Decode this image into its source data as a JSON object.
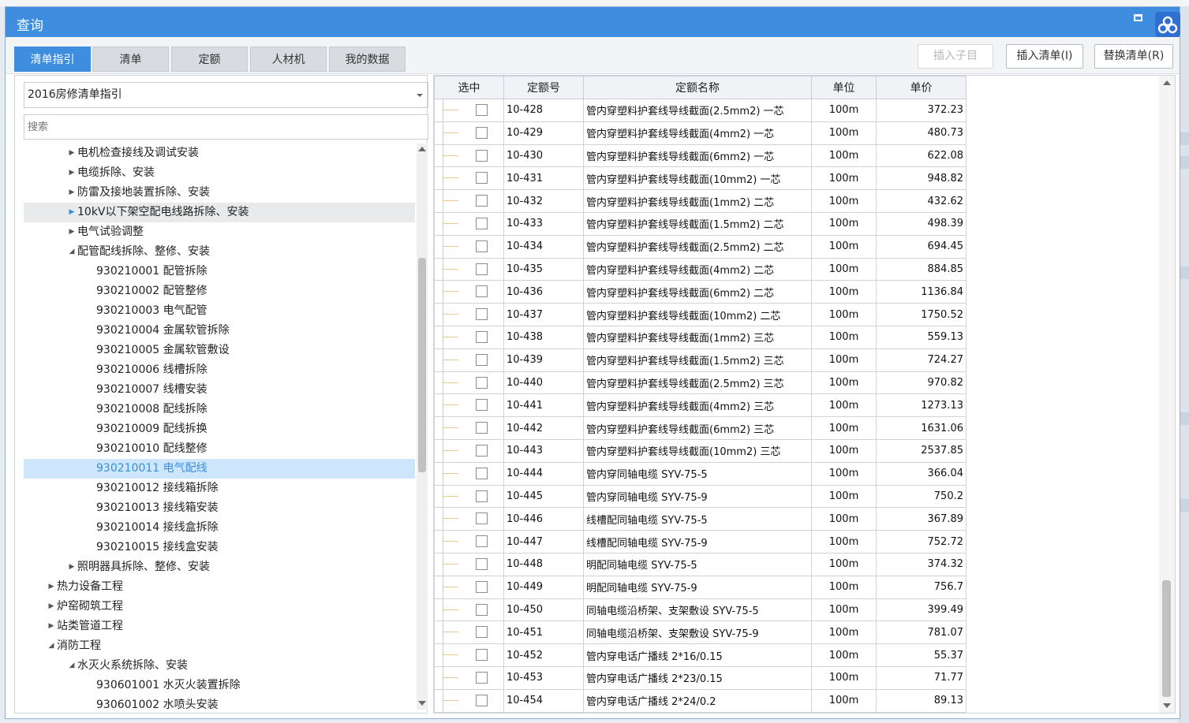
{
  "window": {
    "title": "查询"
  },
  "tabs": [
    {
      "label": "清单指引",
      "active": true
    },
    {
      "label": "清单",
      "active": false
    },
    {
      "label": "定额",
      "active": false
    },
    {
      "label": "人材机",
      "active": false
    },
    {
      "label": "我的数据",
      "active": false
    }
  ],
  "toolbar": {
    "insert_child": "插入子目",
    "insert_list": "插入清单(I)",
    "replace_list": "替换清单(R)"
  },
  "left": {
    "dropdown_value": "2016房修清单指引",
    "search_placeholder": "搜索",
    "tree": [
      {
        "text": "电机检查接线及调试安装",
        "level": 1,
        "state": "collapsed"
      },
      {
        "text": "电缆拆除、安装",
        "level": 1,
        "state": "collapsed"
      },
      {
        "text": "防雷及接地装置拆除、安装",
        "level": 1,
        "state": "collapsed"
      },
      {
        "text": "10kV以下架空配电线路拆除、安装",
        "level": 1,
        "state": "collapsed",
        "hover": true
      },
      {
        "text": "电气试验调整",
        "level": 1,
        "state": "collapsed"
      },
      {
        "text": "配管配线拆除、整修、安装",
        "level": 1,
        "state": "expanded"
      },
      {
        "text": "930210001  配管拆除",
        "level": 2
      },
      {
        "text": "930210002  配管整修",
        "level": 2
      },
      {
        "text": "930210003  电气配管",
        "level": 2
      },
      {
        "text": "930210004  金属软管拆除",
        "level": 2
      },
      {
        "text": "930210005  金属软管敷设",
        "level": 2
      },
      {
        "text": "930210006  线槽拆除",
        "level": 2
      },
      {
        "text": "930210007  线槽安装",
        "level": 2
      },
      {
        "text": "930210008  配线拆除",
        "level": 2
      },
      {
        "text": "930210009  配线拆换",
        "level": 2
      },
      {
        "text": "930210010  配线整修",
        "level": 2
      },
      {
        "text": "930210011  电气配线",
        "level": 2,
        "selected": true
      },
      {
        "text": "930210012  接线箱拆除",
        "level": 2
      },
      {
        "text": "930210013  接线箱安装",
        "level": 2
      },
      {
        "text": "930210014  接线盒拆除",
        "level": 2
      },
      {
        "text": "930210015  接线盒安装",
        "level": 2
      },
      {
        "text": "照明器具拆除、整修、安装",
        "level": 1,
        "state": "collapsed"
      },
      {
        "text": "热力设备工程",
        "level": 0,
        "state": "collapsed"
      },
      {
        "text": "炉窑砌筑工程",
        "level": 0,
        "state": "collapsed"
      },
      {
        "text": "站类管道工程",
        "level": 0,
        "state": "collapsed"
      },
      {
        "text": "消防工程",
        "level": 0,
        "state": "expanded"
      },
      {
        "text": "水灭火系统拆除、安装",
        "level": 1,
        "state": "expanded"
      },
      {
        "text": "930601001  水灭火装置拆除",
        "level": 2
      },
      {
        "text": "930601002  水喷头安装",
        "level": 2
      }
    ]
  },
  "grid": {
    "columns": [
      "选中",
      "定额号",
      "定额名称",
      "单位",
      "单价"
    ],
    "rows": [
      {
        "code": "10-428",
        "name": "管内穿塑料护套线导线截面(2.5mm2) 一芯",
        "unit": "100m",
        "price": "372.23"
      },
      {
        "code": "10-429",
        "name": "管内穿塑料护套线导线截面(4mm2) 一芯",
        "unit": "100m",
        "price": "480.73"
      },
      {
        "code": "10-430",
        "name": "管内穿塑料护套线导线截面(6mm2) 一芯",
        "unit": "100m",
        "price": "622.08"
      },
      {
        "code": "10-431",
        "name": "管内穿塑料护套线导线截面(10mm2) 一芯",
        "unit": "100m",
        "price": "948.82"
      },
      {
        "code": "10-432",
        "name": "管内穿塑料护套线导线截面(1mm2) 二芯",
        "unit": "100m",
        "price": "432.62"
      },
      {
        "code": "10-433",
        "name": "管内穿塑料护套线导线截面(1.5mm2) 二芯",
        "unit": "100m",
        "price": "498.39"
      },
      {
        "code": "10-434",
        "name": "管内穿塑料护套线导线截面(2.5mm2) 二芯",
        "unit": "100m",
        "price": "694.45"
      },
      {
        "code": "10-435",
        "name": "管内穿塑料护套线导线截面(4mm2) 二芯",
        "unit": "100m",
        "price": "884.85"
      },
      {
        "code": "10-436",
        "name": "管内穿塑料护套线导线截面(6mm2) 二芯",
        "unit": "100m",
        "price": "1136.84"
      },
      {
        "code": "10-437",
        "name": "管内穿塑料护套线导线截面(10mm2) 二芯",
        "unit": "100m",
        "price": "1750.52"
      },
      {
        "code": "10-438",
        "name": "管内穿塑料护套线导线截面(1mm2) 三芯",
        "unit": "100m",
        "price": "559.13"
      },
      {
        "code": "10-439",
        "name": "管内穿塑料护套线导线截面(1.5mm2) 三芯",
        "unit": "100m",
        "price": "724.27"
      },
      {
        "code": "10-440",
        "name": "管内穿塑料护套线导线截面(2.5mm2) 三芯",
        "unit": "100m",
        "price": "970.82"
      },
      {
        "code": "10-441",
        "name": "管内穿塑料护套线导线截面(4mm2) 三芯",
        "unit": "100m",
        "price": "1273.13"
      },
      {
        "code": "10-442",
        "name": "管内穿塑料护套线导线截面(6mm2) 三芯",
        "unit": "100m",
        "price": "1631.06"
      },
      {
        "code": "10-443",
        "name": "管内穿塑料护套线导线截面(10mm2) 三芯",
        "unit": "100m",
        "price": "2537.85"
      },
      {
        "code": "10-444",
        "name": "管内穿同轴电缆 SYV-75-5",
        "unit": "100m",
        "price": "366.04"
      },
      {
        "code": "10-445",
        "name": "管内穿同轴电缆 SYV-75-9",
        "unit": "100m",
        "price": "750.2"
      },
      {
        "code": "10-446",
        "name": "线槽配同轴电缆 SYV-75-5",
        "unit": "100m",
        "price": "367.89"
      },
      {
        "code": "10-447",
        "name": "线槽配同轴电缆 SYV-75-9",
        "unit": "100m",
        "price": "752.72"
      },
      {
        "code": "10-448",
        "name": "明配同轴电缆 SYV-75-5",
        "unit": "100m",
        "price": "374.32"
      },
      {
        "code": "10-449",
        "name": "明配同轴电缆 SYV-75-9",
        "unit": "100m",
        "price": "756.7"
      },
      {
        "code": "10-450",
        "name": "同轴电缆沿桥架、支架敷设 SYV-75-5",
        "unit": "100m",
        "price": "399.49"
      },
      {
        "code": "10-451",
        "name": "同轴电缆沿桥架、支架敷设 SYV-75-9",
        "unit": "100m",
        "price": "781.07"
      },
      {
        "code": "10-452",
        "name": "管内穿电话广播线 2*16/0.15",
        "unit": "100m",
        "price": "55.37"
      },
      {
        "code": "10-453",
        "name": "管内穿电话广播线 2*23/0.15",
        "unit": "100m",
        "price": "71.77"
      },
      {
        "code": "10-454",
        "name": "管内穿电话广播线 2*24/0.2",
        "unit": "100m",
        "price": "89.13"
      }
    ]
  }
}
